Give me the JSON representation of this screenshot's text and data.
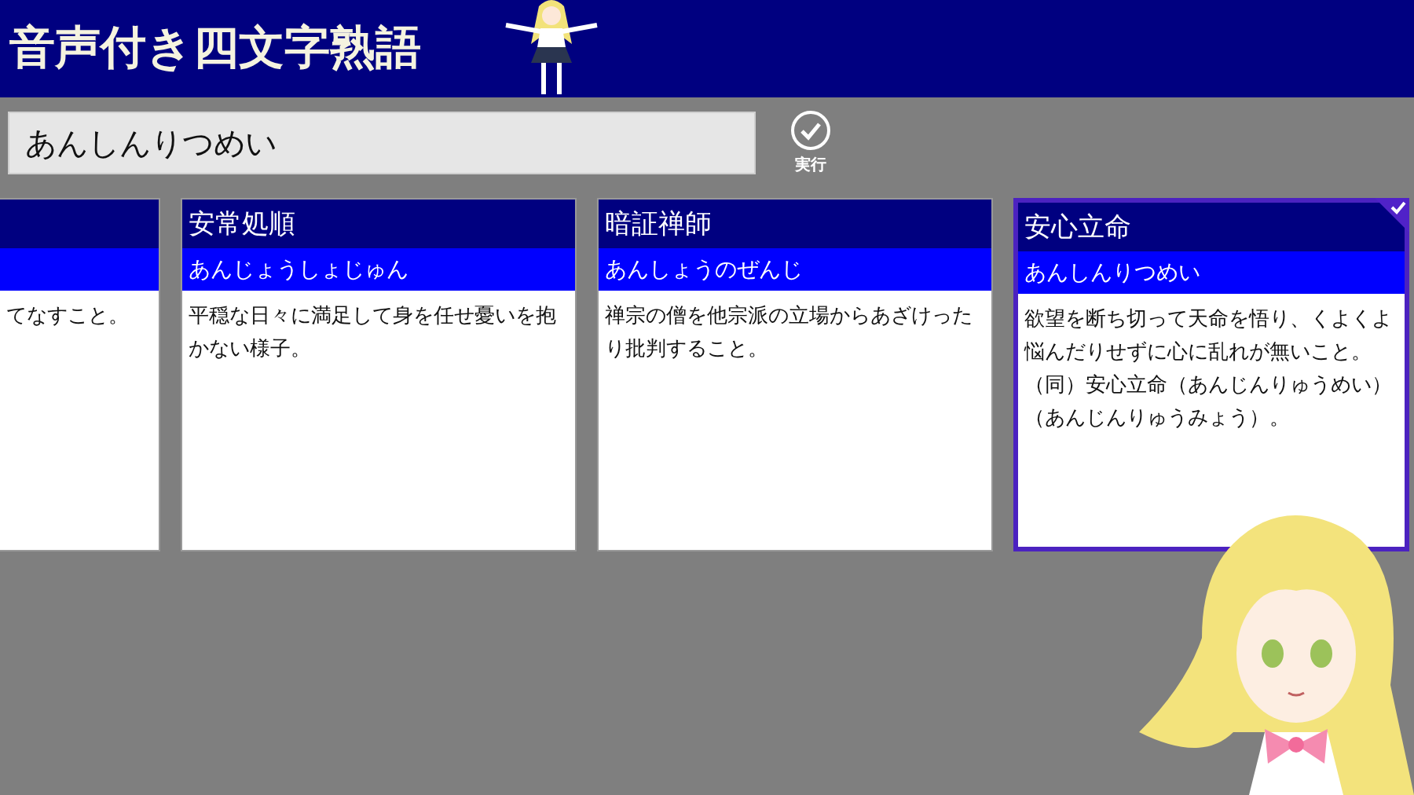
{
  "header": {
    "title": "音声付き四文字熟語"
  },
  "search": {
    "value": "あんしんりつめい",
    "button_label": "実行"
  },
  "partial_card": {
    "description": "てなすこと。"
  },
  "cards": [
    {
      "title": "安常処順",
      "reading": "あんじょうしょじゅん",
      "description": "平穏な日々に満足して身を任せ憂いを抱かない様子。",
      "selected": false
    },
    {
      "title": "暗証禅師",
      "reading": "あんしょうのぜんじ",
      "description": "禅宗の僧を他宗派の立場からあざけったり批判すること。",
      "selected": false
    },
    {
      "title": "安心立命",
      "reading": "あんしんりつめい",
      "description": "欲望を断ち切って天命を悟り、くよくよ悩んだりせずに心に乱れが無いこと。（同）安心立命（あんじんりゅうめい）（あんじんりゅうみょう）。",
      "selected": true
    }
  ]
}
